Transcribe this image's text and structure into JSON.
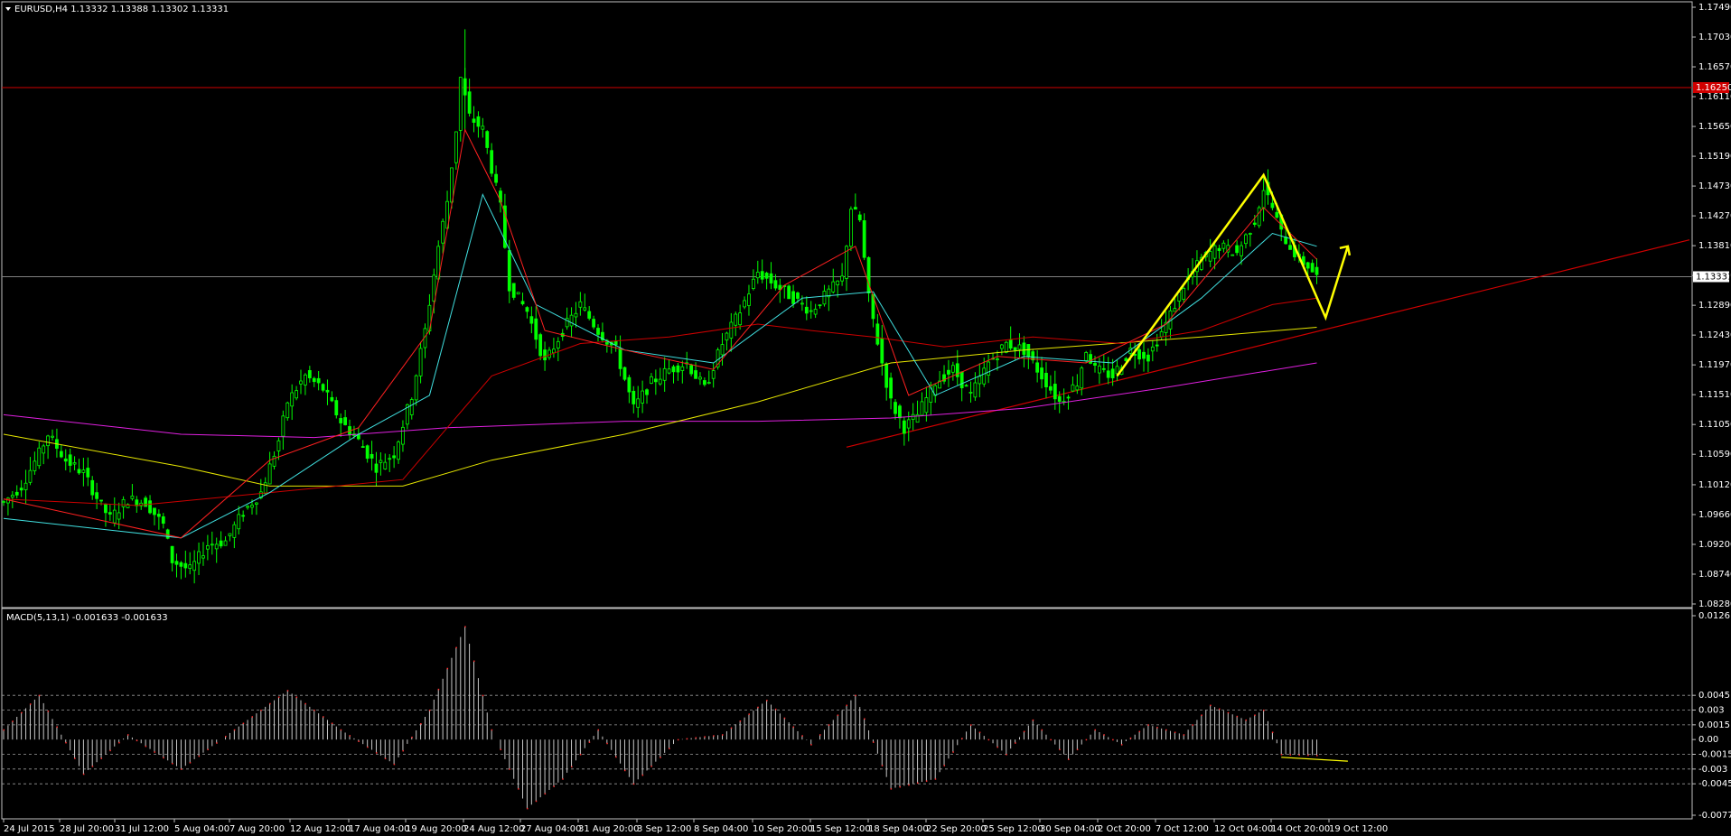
{
  "header": {
    "symbol_line": "EURUSD,H4  1.13332 1.13388 1.13302 1.13331",
    "indicator_line": "MACD(5,13,1) -0.001633 -0.001633"
  },
  "colors": {
    "background": "#000000",
    "border": "#c0c0c0",
    "candle_up": "#00ff00",
    "candle_down": "#00ff00",
    "ma_fast": "#ff2020",
    "ma_mid": "#40e0e0",
    "ma_slow_red": "#cc0000",
    "ma_yellow": "#e6e600",
    "ma_magenta": "#e020e0",
    "resistance_line": "#d00000",
    "trend_line": "#d00000",
    "current_price_line": "#808080",
    "pattern": "#ffff00",
    "macd_hist": "#c8c8c8",
    "macd_signal": "#ff3030"
  },
  "chart_data": [
    {
      "type": "candlestick",
      "symbol": "EURUSD",
      "timeframe": "H4",
      "ohlc_current": {
        "open": 1.13332,
        "high": 1.13388,
        "low": 1.13302,
        "close": 1.13331
      },
      "ylim": [
        1.0828,
        1.1749
      ],
      "y_ticks": [
        "1.17490",
        "1.17030",
        "1.16570",
        "1.16110",
        "1.15650",
        "1.15190",
        "1.14730",
        "1.14270",
        "1.13810",
        "1.13350",
        "1.12890",
        "1.12430",
        "1.11970",
        "1.11510",
        "1.11050",
        "1.10590",
        "1.10120",
        "1.09660",
        "1.09200",
        "1.08740",
        "1.08280"
      ],
      "x_ticks": [
        "24 Jul 2015",
        "28 Jul 20:00",
        "31 Jul 12:00",
        "5 Aug 04:00",
        "7 Aug 20:00",
        "12 Aug 12:00",
        "17 Aug 04:00",
        "19 Aug 20:00",
        "24 Aug 12:00",
        "27 Aug 04:00",
        "31 Aug 20:00",
        "3 Sep 12:00",
        "8 Sep 04:00",
        "10 Sep 20:00",
        "15 Sep 12:00",
        "18 Sep 04:00",
        "22 Sep 20:00",
        "25 Sep 12:00",
        "30 Sep 04:00",
        "2 Oct 20:00",
        "7 Oct 12:00",
        "12 Oct 04:00",
        "14 Oct 20:00",
        "19 Oct 12:00"
      ],
      "resistance_level": 1.1625,
      "resistance_label": "1.16250",
      "current_price_label": "1.13331",
      "close_path": [
        [
          0,
          1.0985
        ],
        [
          4,
          1.101
        ],
        [
          8,
          1.106
        ],
        [
          10,
          1.109
        ],
        [
          14,
          1.105
        ],
        [
          18,
          1.103
        ],
        [
          22,
          1.098
        ],
        [
          24,
          1.096
        ],
        [
          28,
          1.099
        ],
        [
          32,
          1.0985
        ],
        [
          36,
          1.095
        ],
        [
          38,
          1.0895
        ],
        [
          42,
          1.088
        ],
        [
          46,
          1.092
        ],
        [
          50,
          1.0925
        ],
        [
          54,
          1.097
        ],
        [
          58,
          1.1
        ],
        [
          62,
          1.108
        ],
        [
          64,
          1.114
        ],
        [
          68,
          1.118
        ],
        [
          72,
          1.116
        ],
        [
          76,
          1.111
        ],
        [
          80,
          1.108
        ],
        [
          84,
          1.104
        ],
        [
          88,
          1.106
        ],
        [
          92,
          1.115
        ],
        [
          95,
          1.125
        ],
        [
          98,
          1.138
        ],
        [
          100,
          1.145
        ],
        [
          102,
          1.156
        ],
        [
          103,
          1.164
        ],
        [
          105,
          1.158
        ],
        [
          108,
          1.156
        ],
        [
          110,
          1.15
        ],
        [
          112,
          1.144
        ],
        [
          114,
          1.132
        ],
        [
          116,
          1.13
        ],
        [
          118,
          1.128
        ],
        [
          120,
          1.124
        ],
        [
          122,
          1.12
        ],
        [
          126,
          1.125
        ],
        [
          130,
          1.129
        ],
        [
          134,
          1.125
        ],
        [
          138,
          1.122
        ],
        [
          142,
          1.113
        ],
        [
          146,
          1.117
        ],
        [
          150,
          1.119
        ],
        [
          154,
          1.12
        ],
        [
          158,
          1.116
        ],
        [
          162,
          1.123
        ],
        [
          166,
          1.128
        ],
        [
          170,
          1.134
        ],
        [
          174,
          1.132
        ],
        [
          178,
          1.13
        ],
        [
          182,
          1.128
        ],
        [
          186,
          1.131
        ],
        [
          189,
          1.133
        ],
        [
          191,
          1.144
        ],
        [
          193,
          1.142
        ],
        [
          195,
          1.13
        ],
        [
          198,
          1.12
        ],
        [
          200,
          1.114
        ],
        [
          203,
          1.11
        ],
        [
          206,
          1.112
        ],
        [
          210,
          1.117
        ],
        [
          214,
          1.119
        ],
        [
          218,
          1.115
        ],
        [
          222,
          1.12
        ],
        [
          226,
          1.123
        ],
        [
          230,
          1.122
        ],
        [
          234,
          1.118
        ],
        [
          238,
          1.114
        ],
        [
          242,
          1.117
        ],
        [
          244,
          1.122
        ],
        [
          246,
          1.119
        ],
        [
          250,
          1.118
        ],
        [
          254,
          1.122
        ],
        [
          258,
          1.121
        ],
        [
          262,
          1.126
        ],
        [
          266,
          1.132
        ],
        [
          270,
          1.136
        ],
        [
          274,
          1.138
        ],
        [
          278,
          1.137
        ],
        [
          282,
          1.142
        ],
        [
          284,
          1.147
        ],
        [
          286,
          1.144
        ],
        [
          288,
          1.14
        ],
        [
          290,
          1.138
        ],
        [
          292,
          1.136
        ],
        [
          294,
          1.135
        ],
        [
          296,
          1.1333
        ]
      ],
      "sma_fast_path": [
        [
          0,
          1.099
        ],
        [
          40,
          1.093
        ],
        [
          60,
          1.105
        ],
        [
          80,
          1.11
        ],
        [
          96,
          1.125
        ],
        [
          104,
          1.156
        ],
        [
          112,
          1.145
        ],
        [
          122,
          1.125
        ],
        [
          140,
          1.122
        ],
        [
          160,
          1.119
        ],
        [
          176,
          1.132
        ],
        [
          192,
          1.138
        ],
        [
          204,
          1.115
        ],
        [
          224,
          1.121
        ],
        [
          244,
          1.12
        ],
        [
          262,
          1.126
        ],
        [
          284,
          1.144
        ],
        [
          296,
          1.136
        ]
      ],
      "sma_mid_path": [
        [
          0,
          1.096
        ],
        [
          40,
          1.093
        ],
        [
          60,
          1.1
        ],
        [
          80,
          1.109
        ],
        [
          96,
          1.115
        ],
        [
          108,
          1.146
        ],
        [
          120,
          1.129
        ],
        [
          140,
          1.122
        ],
        [
          160,
          1.12
        ],
        [
          180,
          1.13
        ],
        [
          196,
          1.131
        ],
        [
          210,
          1.115
        ],
        [
          230,
          1.121
        ],
        [
          250,
          1.12
        ],
        [
          270,
          1.13
        ],
        [
          286,
          1.14
        ],
        [
          296,
          1.138
        ]
      ],
      "ma_red_slow_path": [
        [
          0,
          1.099
        ],
        [
          30,
          1.098
        ],
        [
          60,
          1.1
        ],
        [
          90,
          1.102
        ],
        [
          110,
          1.118
        ],
        [
          130,
          1.123
        ],
        [
          150,
          1.124
        ],
        [
          170,
          1.126
        ],
        [
          182,
          1.125
        ],
        [
          196,
          1.124
        ],
        [
          212,
          1.1225
        ],
        [
          232,
          1.124
        ],
        [
          252,
          1.123
        ],
        [
          270,
          1.125
        ],
        [
          286,
          1.129
        ],
        [
          296,
          1.13
        ]
      ],
      "ma_yellow_path": [
        [
          0,
          1.109
        ],
        [
          40,
          1.104
        ],
        [
          60,
          1.101
        ],
        [
          90,
          1.101
        ],
        [
          110,
          1.105
        ],
        [
          140,
          1.109
        ],
        [
          170,
          1.114
        ],
        [
          200,
          1.12
        ],
        [
          230,
          1.122
        ],
        [
          250,
          1.123
        ],
        [
          270,
          1.124
        ],
        [
          296,
          1.1255
        ]
      ],
      "ma_magenta_path": [
        [
          0,
          1.112
        ],
        [
          40,
          1.109
        ],
        [
          70,
          1.1085
        ],
        [
          100,
          1.11
        ],
        [
          140,
          1.111
        ],
        [
          170,
          1.111
        ],
        [
          200,
          1.1115
        ],
        [
          230,
          1.113
        ],
        [
          260,
          1.116
        ],
        [
          296,
          1.12
        ]
      ],
      "trend_line": [
        [
          190,
          1.107
        ],
        [
          380,
          1.139
        ]
      ],
      "pattern_path": [
        [
          251,
          1.118
        ],
        [
          284,
          1.149
        ],
        [
          298,
          1.127
        ],
        [
          303,
          1.138
        ]
      ]
    },
    {
      "type": "histogram",
      "title": "MACD(5,13,1)",
      "value": -0.001633,
      "signal": -0.001633,
      "ylim": [
        -0.0077,
        0.0126
      ],
      "y_ticks": [
        "0.0126",
        "0.0045",
        "0.003",
        "0.0015",
        "0.00",
        "-0.0015",
        "-0.003",
        "-0.0045",
        "-0.00770"
      ],
      "levels": [
        0.0045,
        0.003,
        0.0015,
        -0.0015,
        -0.003,
        -0.0045
      ],
      "hist_path": [
        [
          0,
          0.001
        ],
        [
          8,
          0.0045
        ],
        [
          18,
          -0.0035
        ],
        [
          28,
          0.0005
        ],
        [
          40,
          -0.003
        ],
        [
          52,
          0.001
        ],
        [
          64,
          0.005
        ],
        [
          76,
          0.001
        ],
        [
          88,
          -0.0025
        ],
        [
          96,
          0.003
        ],
        [
          104,
          0.0115
        ],
        [
          110,
          0.001
        ],
        [
          118,
          -0.007
        ],
        [
          126,
          -0.004
        ],
        [
          134,
          0.001
        ],
        [
          142,
          -0.0045
        ],
        [
          152,
          0.0
        ],
        [
          162,
          0.0005
        ],
        [
          172,
          0.004
        ],
        [
          182,
          -0.0005
        ],
        [
          192,
          0.0045
        ],
        [
          200,
          -0.005
        ],
        [
          210,
          -0.004
        ],
        [
          218,
          0.0015
        ],
        [
          226,
          -0.0015
        ],
        [
          232,
          0.002
        ],
        [
          240,
          -0.002
        ],
        [
          246,
          0.001
        ],
        [
          252,
          -0.0005
        ],
        [
          258,
          0.0015
        ],
        [
          266,
          0.0005
        ],
        [
          272,
          0.0035
        ],
        [
          280,
          0.002
        ],
        [
          284,
          0.003
        ],
        [
          288,
          -0.0015
        ],
        [
          296,
          -0.0016
        ]
      ],
      "signal_line": [
        [
          288,
          -0.0018
        ],
        [
          303,
          -0.0022
        ]
      ]
    }
  ]
}
